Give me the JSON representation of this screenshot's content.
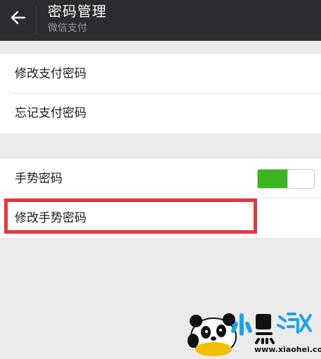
{
  "header": {
    "title": "密码管理",
    "subtitle": "微信支付"
  },
  "group1": {
    "items": [
      {
        "label": "修改支付密码"
      },
      {
        "label": "忘记支付密码"
      }
    ]
  },
  "group2": {
    "items": [
      {
        "label": "手势密码",
        "toggle_on": true
      },
      {
        "label": "修改手势密码"
      }
    ]
  },
  "highlight_color": "#e3373f",
  "accent_color": "#3cb521",
  "watermark": {
    "logo_text": "小黑游戏",
    "url": "www.xiaohei.com"
  }
}
